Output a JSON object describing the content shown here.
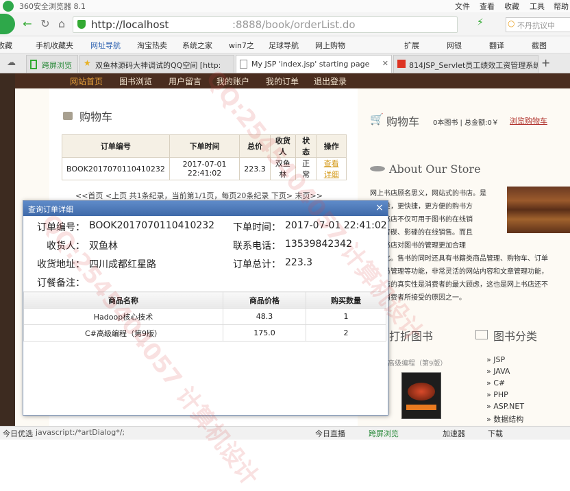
{
  "browser": {
    "title": "360安全浏览器 8.1",
    "menu": [
      "文件",
      "查看",
      "收藏",
      "工具",
      "帮助"
    ],
    "url_host": "http://localhost",
    "url_path": ":8888/book/orderList.do",
    "search_placeholder": "不丹抗议中",
    "bookmarks": [
      "收藏",
      "手机收藏夹",
      "网址导航",
      "淘宝热卖",
      "系统之家",
      "win7之",
      "足球导航",
      "网上购物"
    ],
    "bookmark_right": [
      "扩展",
      "网银",
      "翻译",
      "截图"
    ],
    "tabs": [
      "跨屏浏览",
      "双鱼林源码大神调试的QQ空间 [http:",
      "My JSP 'index.jsp' starting page",
      "814JSP_Servlet员工绩效工资管理系统"
    ],
    "status_left": "今日优选",
    "status_url": "javascript:/*artDialog*/;",
    "status_right": [
      "今日直播",
      "跨屏浏览",
      "加速器",
      "下载"
    ]
  },
  "site": {
    "nav": [
      "网站首页",
      "图书浏览",
      "用户留言",
      "我的账户",
      "我的订单",
      "退出登录"
    ],
    "cart_title": "购物车",
    "orders_table": {
      "headers": [
        "订单编号",
        "下单时间",
        "总价",
        "收货人",
        "状态",
        "操作"
      ],
      "rows": [
        {
          "id": "BOOK2017070110410232",
          "time": "2017-07-01 22:41:02",
          "total": "223.3",
          "receiver": "双鱼林",
          "status": "正常",
          "action": "查看详细"
        }
      ]
    },
    "pager": "<<首页 <上页 共1条纪录，当前第1/1页，每页20条纪录 下页> 末页>>",
    "right": {
      "cart_title": "购物车",
      "cart_summary": "0本图书 | 总金额:0￥",
      "cart_link": "浏览购物车",
      "about_title": "About Our Store",
      "about_lines": [
        "网上书店顾名思义，网站式的书店。是",
        "高质量，更快捷，更方便的购书方",
        "网上书店不仅可用于图书的在线销",
        "也有音碟、影碟的在线销售。而且",
        "式的书店对图书的管理更加合理",
        "信息化。售书的同时还具有书籍类商品管理、购物车、订单",
        "、会员管理等功能，非常灵活的网站内容和文章管理功能，",
        "上书店的真实性是消费者的最大顾虑，这也是网上书店还不",
        "多数消费者所接受的原因之一。"
      ],
      "discount_title": "打折图书",
      "book_caption": "高级编程（第9版）",
      "category_title": "图书分类",
      "categories": [
        "JSP",
        "JAVA",
        "C#",
        "PHP",
        "ASP.NET",
        "数据结构"
      ]
    }
  },
  "dialog": {
    "title": "查询订单详细",
    "order_no_label": "订单编号：",
    "order_no": "BOOK2017070110410232",
    "time_label": "下单时间：",
    "time": "2017-07-01 22:41:02",
    "receiver_label": "收货人：",
    "receiver": "双鱼林",
    "phone_label": "联系电话：",
    "phone": "13539842342",
    "address_label": "收货地址：",
    "address": "四川成都红星路",
    "total_label": "订单总计：",
    "total": "223.3",
    "note_label": "订餐备注：",
    "items_headers": [
      "商品名称",
      "商品价格",
      "购买数量"
    ],
    "items": [
      {
        "name": "Hadoop核心技术",
        "price": "48.3",
        "qty": "1"
      },
      {
        "name": "C#高级编程（第9版）",
        "price": "175.0",
        "qty": "2"
      }
    ]
  },
  "watermark": "QQ:2545404057 计算机设计"
}
